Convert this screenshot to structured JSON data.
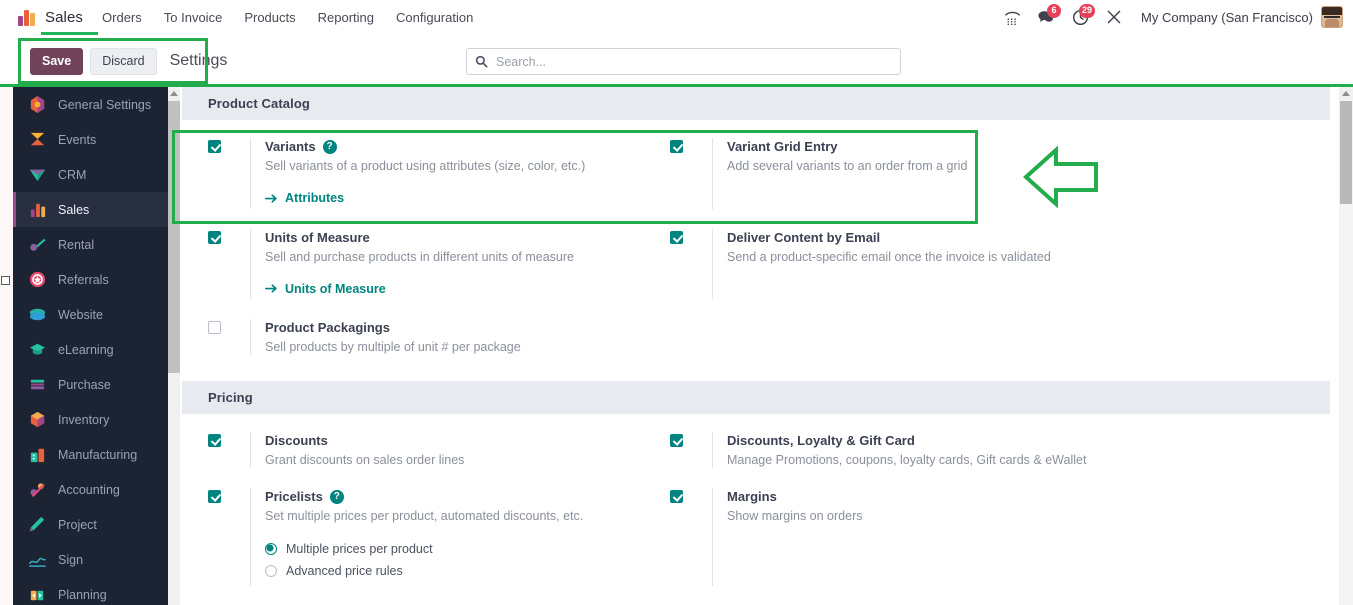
{
  "navbar": {
    "brand": "Sales",
    "brand_icon": "sales-app-icon",
    "menu": [
      "Orders",
      "To Invoice",
      "Products",
      "Reporting",
      "Configuration"
    ],
    "icons": [
      {
        "name": "phone-dialpad-icon",
        "badge": null
      },
      {
        "name": "messages-icon",
        "badge": "6"
      },
      {
        "name": "activities-clock-icon",
        "badge": "29"
      },
      {
        "name": "tools-wrench-icon",
        "badge": null
      }
    ],
    "company": "My Company (San Francisco)",
    "avatar": "user-avatar"
  },
  "control_panel": {
    "save_label": "Save",
    "discard_label": "Discard",
    "breadcrumb_title": "Settings",
    "search_placeholder": "Search...",
    "search_value": ""
  },
  "sidebar": {
    "items": [
      {
        "label": "General Settings",
        "icon": "general-settings-icon",
        "active": false
      },
      {
        "label": "Events",
        "icon": "events-icon",
        "active": false
      },
      {
        "label": "CRM",
        "icon": "crm-icon",
        "active": false
      },
      {
        "label": "Sales",
        "icon": "sales-icon",
        "active": true
      },
      {
        "label": "Rental",
        "icon": "rental-icon",
        "active": false
      },
      {
        "label": "Referrals",
        "icon": "referrals-icon",
        "active": false
      },
      {
        "label": "Website",
        "icon": "website-icon",
        "active": false
      },
      {
        "label": "eLearning",
        "icon": "elearning-icon",
        "active": false
      },
      {
        "label": "Purchase",
        "icon": "purchase-icon",
        "active": false
      },
      {
        "label": "Inventory",
        "icon": "inventory-icon",
        "active": false
      },
      {
        "label": "Manufacturing",
        "icon": "manufacturing-icon",
        "active": false
      },
      {
        "label": "Accounting",
        "icon": "accounting-icon",
        "active": false
      },
      {
        "label": "Project",
        "icon": "project-icon",
        "active": false
      },
      {
        "label": "Sign",
        "icon": "sign-icon",
        "active": false
      },
      {
        "label": "Planning",
        "icon": "planning-icon",
        "active": false
      }
    ]
  },
  "sections": [
    {
      "title": "Product Catalog",
      "settings": [
        {
          "title": "Variants",
          "desc": "Sell variants of a product using attributes (size, color, etc.)",
          "checked": true,
          "help": "?",
          "link": "Attributes"
        },
        {
          "title": "Variant Grid Entry",
          "desc": "Add several variants to an order from a grid",
          "checked": true,
          "help": null,
          "link": null
        },
        {
          "title": "Units of Measure",
          "desc": "Sell and purchase products in different units of measure",
          "checked": true,
          "help": null,
          "link": "Units of Measure"
        },
        {
          "title": "Deliver Content by Email",
          "desc": "Send a product-specific email once the invoice is validated",
          "checked": true,
          "help": null,
          "link": null
        },
        {
          "title": "Product Packagings",
          "desc": "Sell products by multiple of unit # per package",
          "checked": false,
          "help": null,
          "link": null
        }
      ]
    },
    {
      "title": "Pricing",
      "settings": [
        {
          "title": "Discounts",
          "desc": "Grant discounts on sales order lines",
          "checked": true,
          "help": null,
          "link": null
        },
        {
          "title": "Discounts, Loyalty & Gift Card",
          "desc": "Manage Promotions, coupons, loyalty cards, Gift cards & eWallet",
          "checked": true,
          "help": null,
          "link": null
        },
        {
          "title": "Pricelists",
          "desc": "Set multiple prices per product, automated discounts, etc.",
          "checked": true,
          "help": "?",
          "link": null,
          "radios": [
            {
              "label": "Multiple prices per product",
              "selected": true
            },
            {
              "label": "Advanced price rules",
              "selected": false
            }
          ]
        },
        {
          "title": "Margins",
          "desc": "Show margins on orders",
          "checked": true,
          "help": null,
          "link": null
        }
      ]
    }
  ],
  "annotations": {
    "highlight_tools": "green-box-around-save-discard-settings",
    "highlight_variants": "green-box-around-variants-row",
    "arrow": "green-left-arrow-pointing-to-variants"
  },
  "colors": {
    "accent_teal": "#00847f",
    "save_purple": "#71435b",
    "annotation_green": "#22ac4b",
    "sidebar_bg": "#1c2333",
    "section_header_bg": "#e7eaee"
  }
}
